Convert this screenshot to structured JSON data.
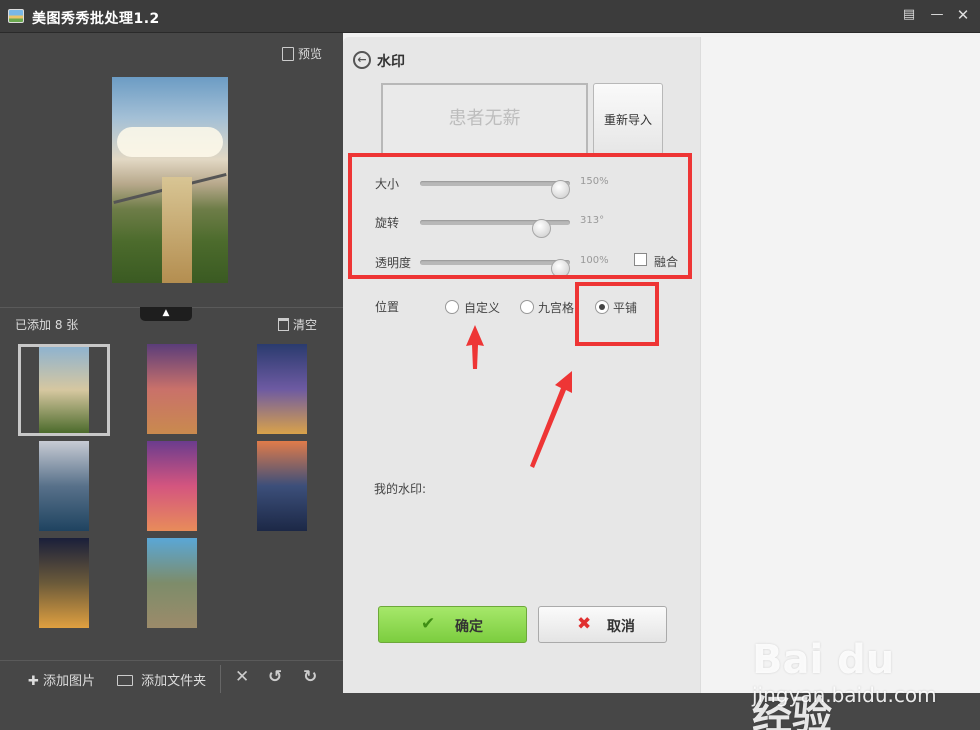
{
  "window": {
    "title": "美图秀秀批处理1.2",
    "controls": [
      "feedback-icon",
      "minimize-icon",
      "close-icon"
    ]
  },
  "left": {
    "preview_label": "预览",
    "added_count": "已添加 8 张",
    "clear_label": "清空",
    "thumbnails": [
      {
        "subject": "bridge-balloons",
        "selected": true,
        "colors": [
          "#8fb3cf",
          "#d6c7a0",
          "#4c6b2c"
        ]
      },
      {
        "subject": "sphinx",
        "selected": false,
        "colors": [
          "#5b3d7a",
          "#c9716a",
          "#c98a4e"
        ]
      },
      {
        "subject": "city-night-skyline",
        "selected": false,
        "colors": [
          "#2a3b6e",
          "#6d5aa2",
          "#d9a24a"
        ]
      },
      {
        "subject": "city-aerial",
        "selected": false,
        "colors": [
          "#c7cbd4",
          "#58718a",
          "#1f4360"
        ]
      },
      {
        "subject": "antelope-canyon",
        "selected": false,
        "colors": [
          "#6b3c8e",
          "#d4557f",
          "#e88c5a"
        ]
      },
      {
        "subject": "skyscraper-sunset",
        "selected": false,
        "colors": [
          "#e07c4a",
          "#3c4f7a",
          "#1c2846"
        ]
      },
      {
        "subject": "tower-night-traffic",
        "selected": false,
        "colors": [
          "#1a1f3a",
          "#6b5a3a",
          "#e0a040"
        ]
      },
      {
        "subject": "hillside-town",
        "selected": false,
        "colors": [
          "#5aa7d6",
          "#7d8c6a",
          "#9c8b6a"
        ]
      }
    ],
    "toolbar": {
      "add_image": "添加图片",
      "add_folder": "添加文件夹"
    }
  },
  "panel": {
    "title": "水印",
    "watermark_text": "患者无薪",
    "reimport": "重新导入",
    "sliders": [
      {
        "label": "大小",
        "value_text": "150%",
        "fraction": 0.94
      },
      {
        "label": "旋转",
        "value_text": "313°",
        "fraction": 0.81
      },
      {
        "label": "透明度",
        "value_text": "100%",
        "fraction": 0.94
      }
    ],
    "blend_label": "融合",
    "position_label": "位置",
    "position_options": [
      "自定义",
      "九宫格",
      "平铺"
    ],
    "position_selected": "平铺",
    "my_watermark": "我的水印:",
    "confirm": "确定",
    "cancel": "取消"
  },
  "branding": {
    "logo_text": "Bai du 经验",
    "url": "jingyan.baidu.com"
  },
  "colors": {
    "highlight": "#ee3535",
    "confirm_green": "#7ccd3f",
    "dark_panel": "#474747"
  }
}
